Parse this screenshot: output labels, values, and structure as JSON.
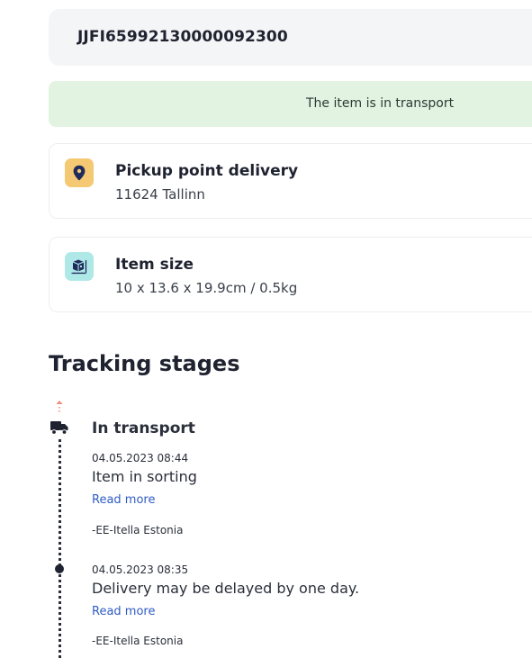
{
  "tracking": {
    "number": "JJFI65992130000092300"
  },
  "status": {
    "text": "The item is in transport"
  },
  "pickup": {
    "icon": "map-pin-icon",
    "title": "Pickup point delivery",
    "subtitle": "11624 Tallinn"
  },
  "size": {
    "icon": "package-size-icon",
    "title": "Item size",
    "subtitle": "10 x 13.6 x 19.9cm / 0.5kg"
  },
  "stages": {
    "heading": "Tracking stages",
    "current_stage": "In transport",
    "events": [
      {
        "datetime": "04.05.2023 08:44",
        "description": "Item in sorting",
        "read_more": "Read more",
        "source": "-EE-Itella Estonia"
      },
      {
        "datetime": "04.05.2023 08:35",
        "description": "Delivery may be delayed by one day.",
        "read_more": "Read more",
        "source": "-EE-Itella Estonia"
      }
    ]
  },
  "colors": {
    "status_bg": "#e2f3e1",
    "pin_badge": "#f5c973",
    "size_badge": "#aee8e7",
    "link": "#2f5cc4",
    "arrow_accent": "#f08a7e"
  }
}
